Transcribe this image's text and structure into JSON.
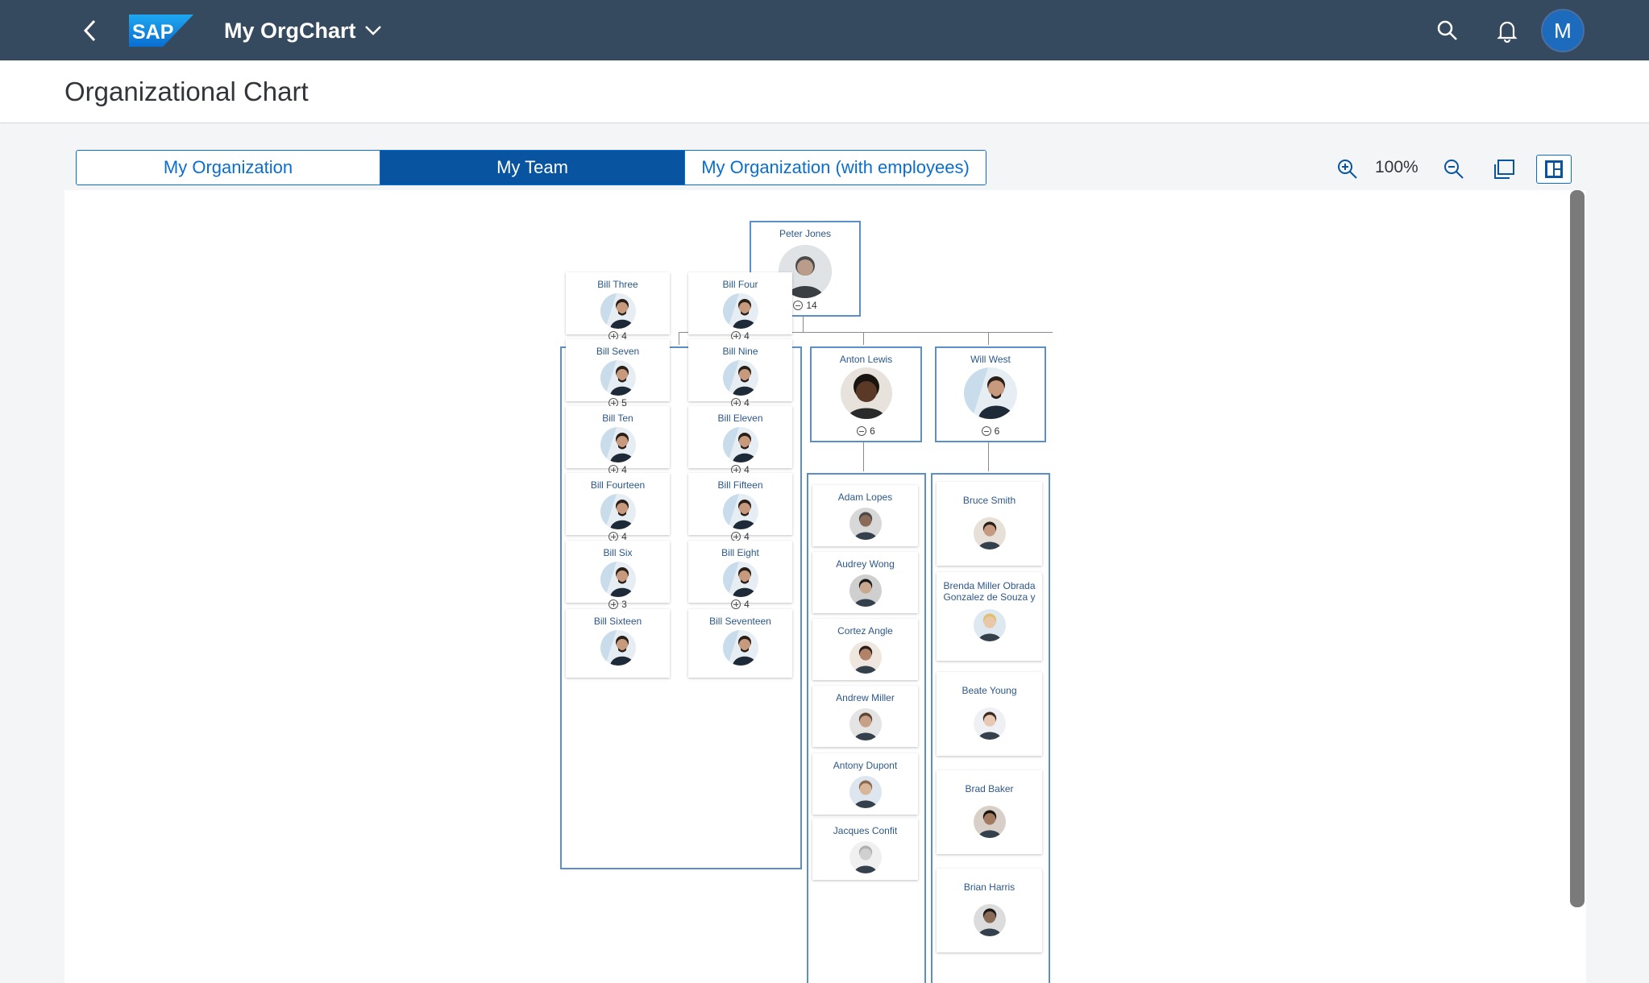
{
  "shell": {
    "app_title": "My OrgChart",
    "avatar_initial": "M",
    "colors": {
      "shell_bg": "#354a5f",
      "accent": "#0a6ed1",
      "selected_seg": "#0854a0"
    }
  },
  "page": {
    "title": "Organizational Chart"
  },
  "tabs": [
    {
      "label": "My Organization",
      "active": false
    },
    {
      "label": "My Team",
      "active": true
    },
    {
      "label": "My Organization (with employees)",
      "active": false
    }
  ],
  "toolbar": {
    "zoom_level": "100%"
  },
  "org": {
    "root": {
      "name": "Peter Jones",
      "count": "14",
      "expanded": true
    },
    "group_left": [
      {
        "name": "Bill Three",
        "count": "4"
      },
      {
        "name": "Bill Four",
        "count": "4"
      },
      {
        "name": "Bill Seven",
        "count": "5"
      },
      {
        "name": "Bill Nine",
        "count": "4"
      },
      {
        "name": "Bill Ten",
        "count": "4"
      },
      {
        "name": "Bill Eleven",
        "count": "4"
      },
      {
        "name": "Bill Fourteen",
        "count": "4"
      },
      {
        "name": "Bill Fifteen",
        "count": "4"
      },
      {
        "name": "Bill Six",
        "count": "3"
      },
      {
        "name": "Bill Eight",
        "count": "4"
      },
      {
        "name": "Bill Sixteen",
        "count": ""
      },
      {
        "name": "Bill Seventeen",
        "count": ""
      }
    ],
    "anton": {
      "name": "Anton Lewis",
      "count": "6"
    },
    "will": {
      "name": "Will West",
      "count": "6"
    },
    "anton_reports": [
      {
        "name": "Adam Lopes"
      },
      {
        "name": "Audrey Wong"
      },
      {
        "name": "Cortez Angle"
      },
      {
        "name": "Andrew Miller"
      },
      {
        "name": "Antony Dupont"
      },
      {
        "name": "Jacques Confit"
      }
    ],
    "will_reports": [
      {
        "name": "Bruce Smith"
      },
      {
        "name": "Brenda Miller Obrada Gonzalez de Souza y"
      },
      {
        "name": "Beate Young"
      },
      {
        "name": "Brad Baker"
      },
      {
        "name": "Brian Harris"
      }
    ]
  }
}
